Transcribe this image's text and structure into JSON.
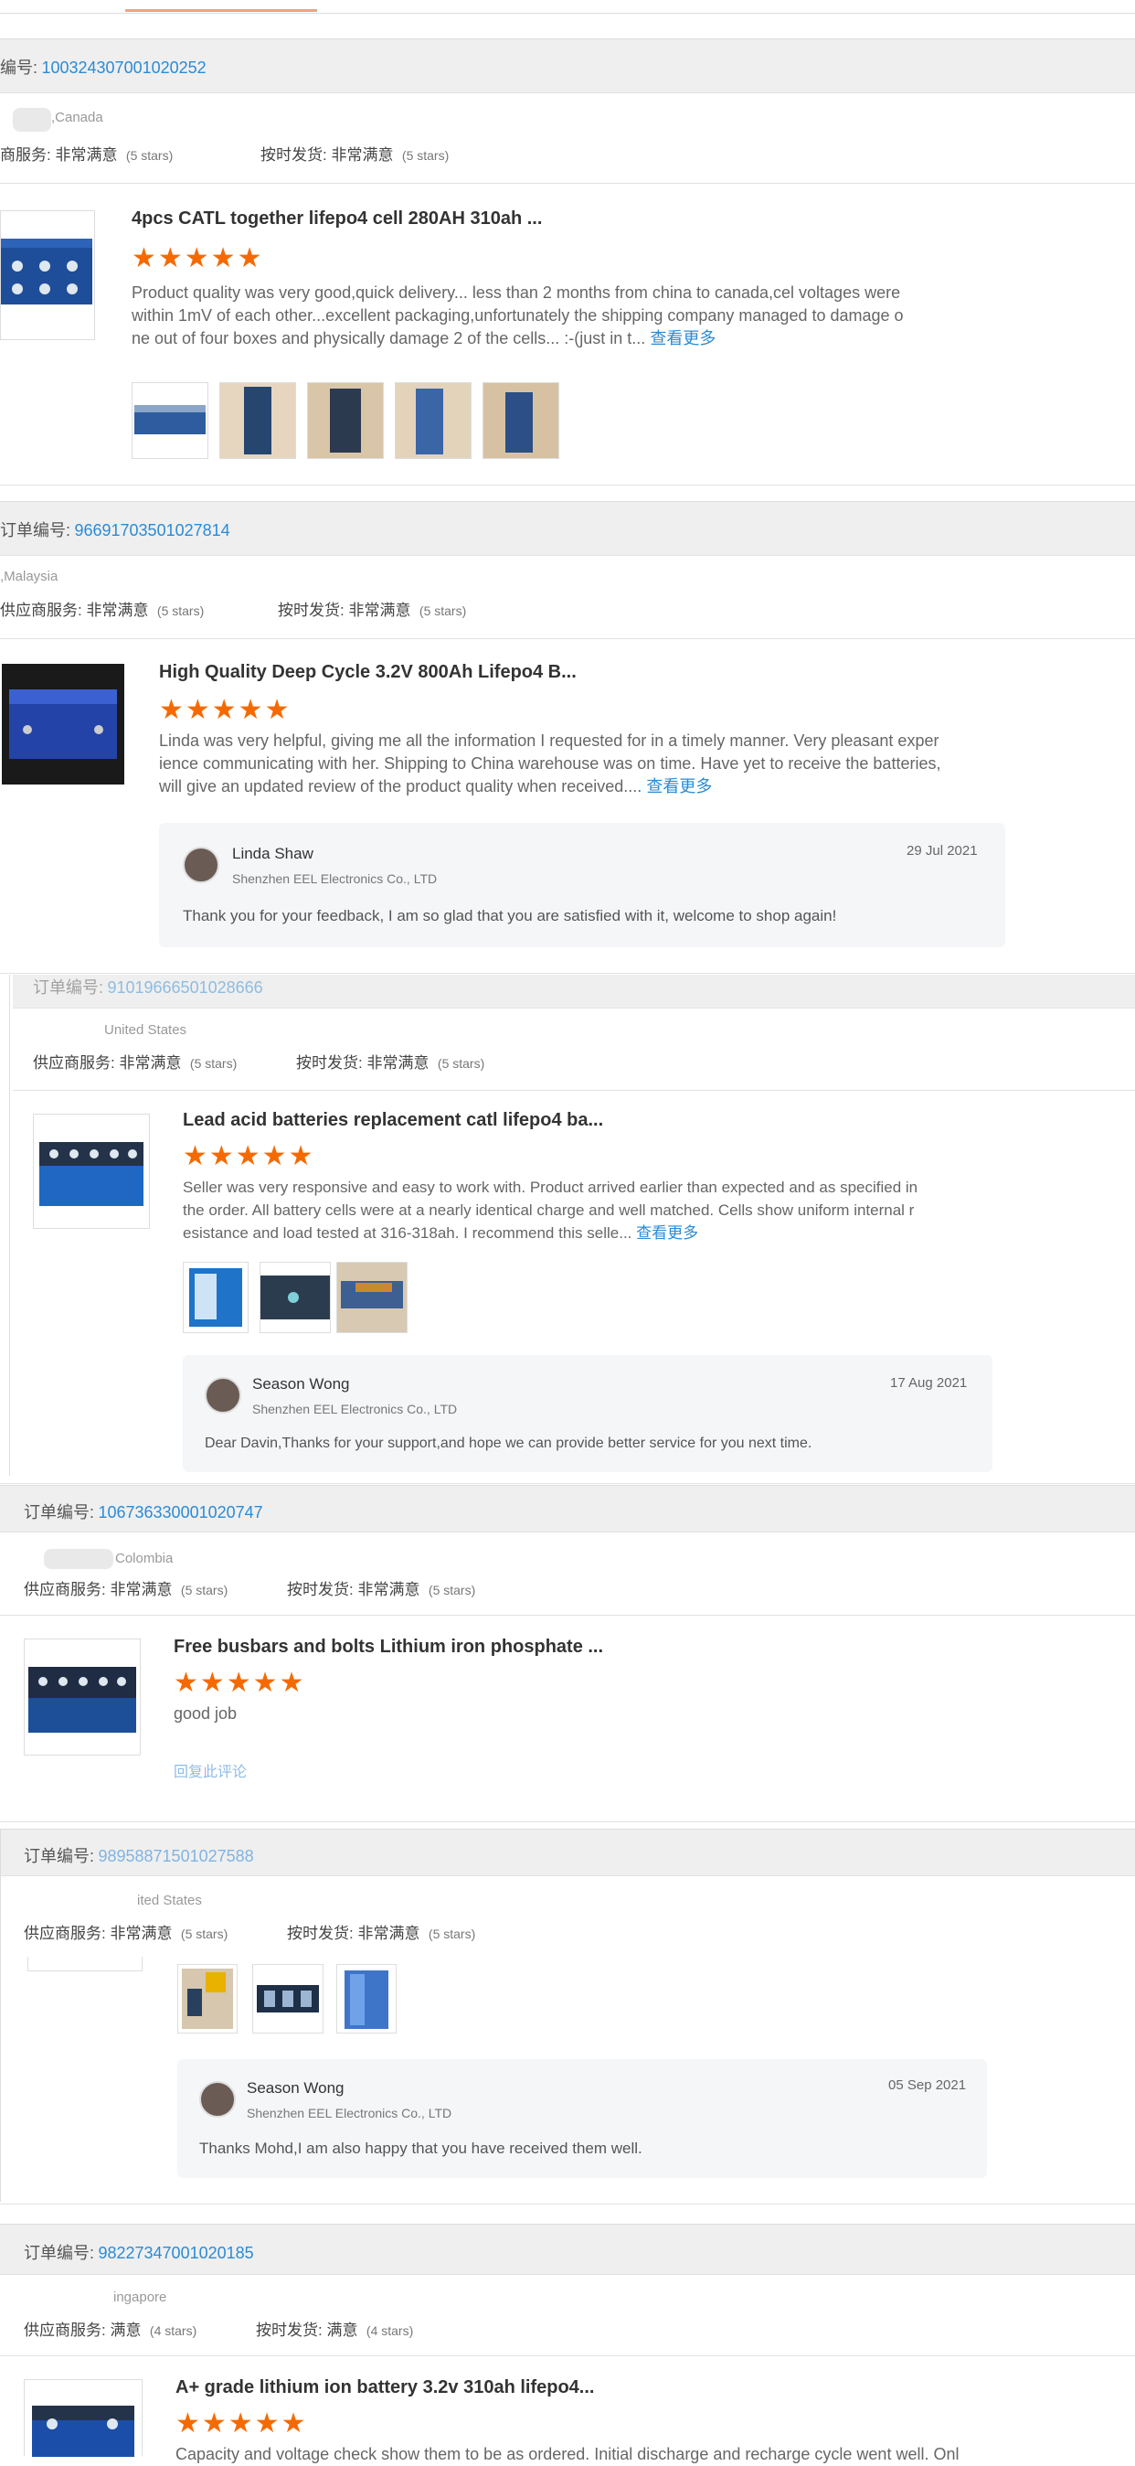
{
  "reviews": [
    {
      "order_label": "编号:",
      "order_no": "100324307001020252",
      "country": ",Canada",
      "supplier_label": "商服务:",
      "supplier_value": "非常满意",
      "supplier_stars": "(5 stars)",
      "ship_label": "按时发货:",
      "ship_value": "非常满意",
      "ship_stars": "(5 stars)",
      "product_title": "4pcs CATL together lifepo4 cell 280AH 310ah ...",
      "stars": "★★★★★",
      "text_1": "Product quality was very good,quick delivery... less than 2 months from china to canada,cel voltages were",
      "text_2": "within 1mV of each other...excellent packaging,unfortunately the shipping company managed to damage o",
      "text_3": "ne out of four boxes and physically damage 2 of the cells... :-(just in t...",
      "more": "查看更多"
    },
    {
      "order_label": "订单编号:",
      "order_no": "96691703501027814",
      "country": ",Malaysia",
      "supplier_label": "供应商服务:",
      "supplier_value": "非常满意",
      "supplier_stars": "(5 stars)",
      "ship_label": "按时发货:",
      "ship_value": "非常满意",
      "ship_stars": "(5 stars)",
      "product_title": "High Quality Deep Cycle 3.2V 800Ah Lifepo4 B...",
      "stars": "★★★★★",
      "text_1": "Linda was very helpful, giving me all the information I requested for in a timely manner. Very pleasant exper",
      "text_2": "ience communicating with her. Shipping to China warehouse was on time. Have yet to receive the batteries,",
      "text_3": "will give an updated review of the product quality when received....",
      "more": "查看更多",
      "reply_name": "Linda Shaw",
      "reply_company": "Shenzhen EEL Electronics Co., LTD",
      "reply_date": "29 Jul 2021",
      "reply_text": "Thank you for your feedback, I am so glad that you are satisfied with it,  welcome to shop again!"
    },
    {
      "order_label": "订单编号:",
      "order_no": "91019666501028666",
      "country": "United States",
      "supplier_label": "供应商服务:",
      "supplier_value": "非常满意",
      "supplier_stars": "(5 stars)",
      "ship_label": "按时发货:",
      "ship_value": "非常满意",
      "ship_stars": "(5 stars)",
      "product_title": "Lead acid batteries replacement catl lifepo4 ba...",
      "stars": "★★★★★",
      "text_1": "Seller was very responsive and easy to work with. Product arrived earlier than expected and as specified in",
      "text_2": "the order. All battery cells were at a nearly identical charge and well matched. Cells show uniform internal r",
      "text_3": "esistance and load tested at 316-318ah. I recommend this selle...",
      "more": "查看更多",
      "reply_name": "Season Wong",
      "reply_company": "Shenzhen EEL Electronics Co., LTD",
      "reply_date": "17 Aug 2021",
      "reply_text": "Dear Davin,Thanks for your support,and hope we can provide better service for you next time."
    },
    {
      "order_label": "订单编号:",
      "order_no": "106736330001020747",
      "country": "Colombia",
      "supplier_label": "供应商服务:",
      "supplier_value": "非常满意",
      "supplier_stars": "(5 stars)",
      "ship_label": "按时发货:",
      "ship_value": "非常满意",
      "ship_stars": "(5 stars)",
      "product_title": "Free busbars and bolts Lithium iron phosphate ...",
      "stars": "★★★★★",
      "text_1": "good job",
      "reply_link": "回复此评论"
    },
    {
      "order_label": "订单编号:",
      "order_no": "98958871501027588",
      "country": "ited States",
      "supplier_label": "供应商服务:",
      "supplier_value": "非常满意",
      "supplier_stars": "(5 stars)",
      "ship_label": "按时发货:",
      "ship_value": "非常满意",
      "ship_stars": "(5 stars)",
      "reply_name": "Season Wong",
      "reply_company": "Shenzhen EEL Electronics Co., LTD",
      "reply_date": "05 Sep 2021",
      "reply_text": "Thanks Mohd,I am also happy that you have received them well."
    },
    {
      "order_label": "订单编号:",
      "order_no": "98227347001020185",
      "country": "ingapore",
      "supplier_label": "供应商服务:",
      "supplier_value": "满意",
      "supplier_stars": "(4 stars)",
      "ship_label": "按时发货:",
      "ship_value": "满意",
      "ship_stars": "(4 stars)",
      "product_title": "A+ grade lithium ion battery 3.2v 310ah lifepo4...",
      "stars": "★★★★★",
      "text_1": "Capacity and voltage check show them to be as ordered. Initial discharge and recharge cycle went well. Onl"
    }
  ],
  "icons": {
    "star": "star-icon",
    "avatar": "avatar"
  },
  "colors": {
    "accent_star": "#f56a00",
    "link": "#2a8bd6",
    "bar_bg": "#efefef"
  }
}
